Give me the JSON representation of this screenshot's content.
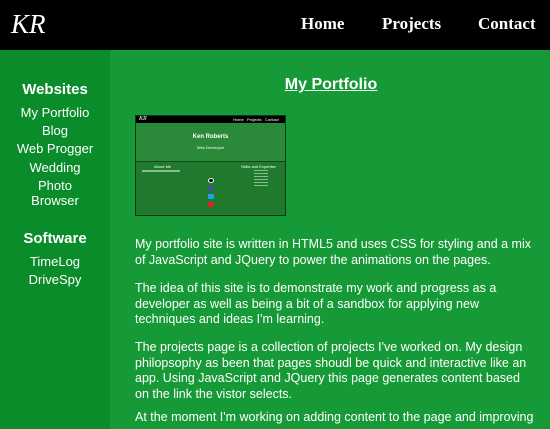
{
  "header": {
    "logo": "KR",
    "nav": [
      "Home",
      "Projects",
      "Contact"
    ]
  },
  "sidebar": {
    "sections": [
      {
        "heading": "Websites",
        "items": [
          "My Portfolio",
          "Blog",
          "Web Progger",
          "Wedding",
          "Photo",
          "Browser"
        ]
      },
      {
        "heading": "Software",
        "items": [
          "TimeLog",
          "DriveSpy"
        ]
      }
    ]
  },
  "main": {
    "title": "My Portfolio",
    "thumbnail": {
      "logo": "KR",
      "nav": [
        "Home",
        "Projects",
        "Contact"
      ],
      "name": "Ken Roberts",
      "role": "Web Developer",
      "col_left": "About Me",
      "col_right": "Skills and Expertise"
    },
    "paragraphs": [
      "My portfolio site is written in HTML5 and uses CSS for styling and a mix of JavaScript and JQuery to power the animations on the pages.",
      "The idea of this site is to demonstrate my work and progress as a developer as well as being a bit of a sandbox for applying new techniques and ideas I'm learning.",
      "The projects page is a collection of projects I've worked on. My design philopsophy as been that pages shoudl be quick and interactive like an app. Using JavaScript and JQuery this page generates content based on the link the vistor selects.",
      "At the moment I'm working on adding content to the page and improving"
    ]
  },
  "colors": {
    "header_bg": "#000000",
    "sidebar_bg": "#0b8c2a",
    "main_bg": "#169a37",
    "text": "#ffffff"
  }
}
